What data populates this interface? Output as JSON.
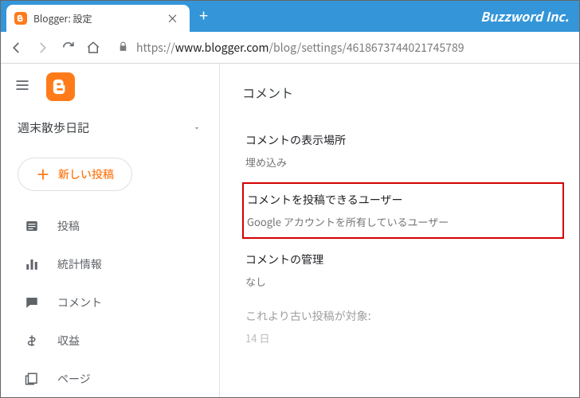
{
  "browser": {
    "tab_title": "Blogger: 設定",
    "brand": "Buzzword Inc.",
    "url_prefix": "https://",
    "url_host": "www.blogger.com",
    "url_path": "/blog/settings/4618673744021745789"
  },
  "sidebar": {
    "blog_name": "週末散歩日記",
    "new_post": "新しい投稿",
    "items": [
      {
        "label": "投稿"
      },
      {
        "label": "統計情報"
      },
      {
        "label": "コメント"
      },
      {
        "label": "収益"
      },
      {
        "label": "ページ"
      }
    ]
  },
  "main": {
    "section": "コメント",
    "settings": [
      {
        "label": "コメントの表示場所",
        "value": "埋め込み"
      },
      {
        "label": "コメントを投稿できるユーザー",
        "value": "Google アカウントを所有しているユーザー"
      },
      {
        "label": "コメントの管理",
        "value": "なし"
      },
      {
        "label": "これより古い投稿が対象:",
        "value": "14 日"
      }
    ]
  }
}
